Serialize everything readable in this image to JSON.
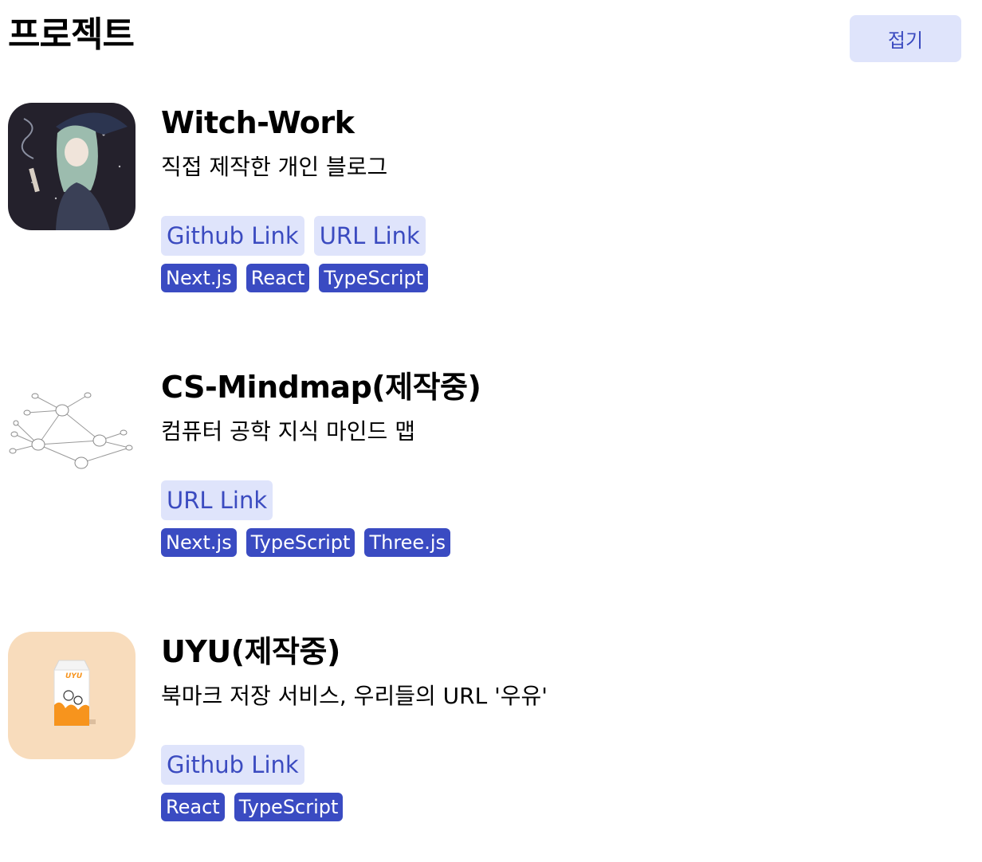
{
  "header": {
    "title": "프로젝트",
    "collapse_label": "접기"
  },
  "projects": [
    {
      "title": "Witch-Work",
      "description": "직접 제작한 개인 블로그",
      "links": [
        "Github Link",
        "URL Link"
      ],
      "tags": [
        "Next.js",
        "React",
        "TypeScript"
      ]
    },
    {
      "title": "CS-Mindmap(제작중)",
      "description": "컴퓨터 공학 지식 마인드 맵",
      "links": [
        "URL Link"
      ],
      "tags": [
        "Next.js",
        "TypeScript",
        "Three.js"
      ]
    },
    {
      "title": "UYU(제작중)",
      "description": "북마크 저장 서비스, 우리들의 URL '우유'",
      "links": [
        "Github Link"
      ],
      "tags": [
        "React",
        "TypeScript"
      ],
      "thumbnail_text": "UYU"
    }
  ],
  "colors": {
    "chip_background": "#dfe4fb",
    "chip_text": "#3b4bc0",
    "tag_background": "#3a4bc2",
    "tag_text": "#ffffff",
    "uyu_thumb_background": "#f8dcbc"
  },
  "icons": {
    "project_1": "witch-illustration-thumbnail",
    "project_2": "mindmap-graph-thumbnail",
    "project_3": "milk-carton-thumbnail"
  }
}
